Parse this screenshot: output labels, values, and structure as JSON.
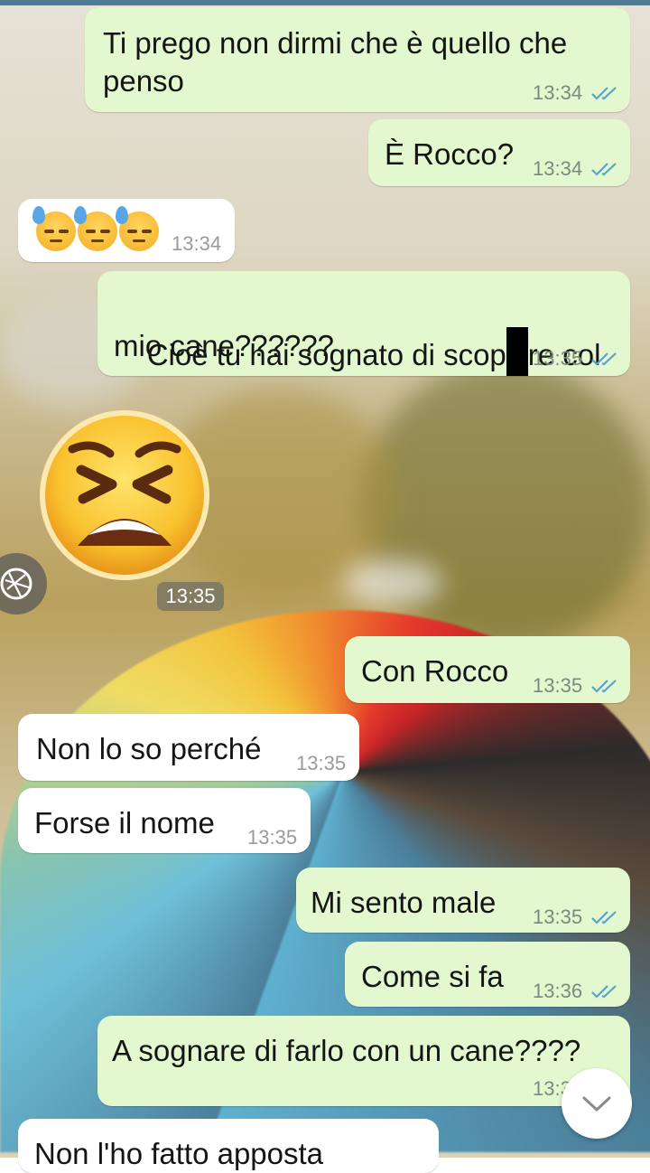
{
  "colors": {
    "outgoing": "#e3f8cf",
    "incoming": "#ffffff",
    "ticks": "#5aa3c9"
  },
  "messages": [
    {
      "text": "Ti prego non dirmi che è quello che\npenso",
      "time": "13:34",
      "status": "read-double-check-icon"
    },
    {
      "text": "È Rocco?",
      "time": "13:34",
      "status": "read-double-check-icon"
    },
    {
      "emoji": [
        "sweat-face-icon",
        "sweat-face-icon",
        "sweat-face-icon"
      ],
      "time": "13:34"
    },
    {
      "text_a": "Cioè tu hai sognato di scop",
      "text_b": "re col",
      "text_c": "mio cane??????",
      "time": "13:35",
      "status": "read-double-check-icon"
    },
    {
      "sticker": "tired-face-sticker",
      "time": "13:35"
    },
    {
      "text": "Con Rocco",
      "time": "13:35",
      "status": "read-double-check-icon"
    },
    {
      "text": "Non lo so perché",
      "time": "13:35"
    },
    {
      "text": "Forse il nome",
      "time": "13:35"
    },
    {
      "text": "Mi sento male",
      "time": "13:35",
      "status": "read-double-check-icon"
    },
    {
      "text": "Come si fa",
      "time": "13:36",
      "status": "read-double-check-icon"
    },
    {
      "text": "A sognare di farlo con un cane????",
      "time": "13:3"
    },
    {
      "text": "Non l'ho fatto apposta"
    }
  ]
}
